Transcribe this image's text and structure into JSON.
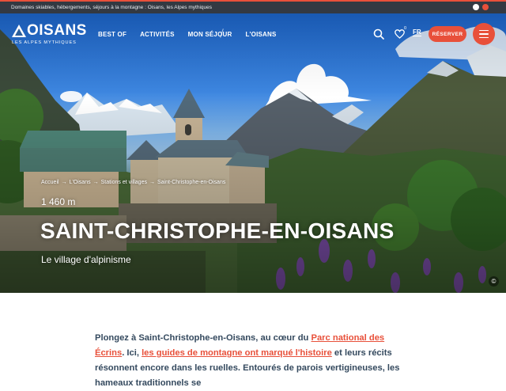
{
  "topbar": {
    "text": "Domaines skiables, hébergements, séjours à la montagne : Oisans, les Alpes mythiques"
  },
  "logo": {
    "name": "OISANS",
    "tagline": "LES ALPES MYTHIQUES"
  },
  "nav": {
    "items": [
      "BEST OF",
      "ACTIVITÉS",
      "MON SÉJOUR",
      "L'OISANS"
    ]
  },
  "header_actions": {
    "search_icon": "search-icon",
    "favorites_count": "0",
    "language": "FR",
    "reserve_label": "RÉSERVER",
    "menu_icon": "hamburger-icon"
  },
  "hero": {
    "breadcrumb": [
      "Accueil",
      "L'Oisans",
      "Stations et villages",
      "Saint-Christophe-en-Oisans"
    ],
    "altitude": "1 460 m",
    "title": "SAINT-CHRISTOPHE-EN-OISANS",
    "subtitle": "Le village d'alpinisme",
    "copyright_symbol": "©"
  },
  "intro": {
    "part1": "Plongez à Saint-Christophe-en-Oisans, au cœur du ",
    "link1": "Parc national des Écrins",
    "part2": ". Ici, ",
    "link2": "les guides de montagne ont marqué l'histoire",
    "part3": " et leurs récits résonnent encore dans les ruelles. Entourés de parois vertigineuses, les hameaux traditionnels se"
  },
  "colors": {
    "accent": "#e8503a",
    "topbar": "#333942",
    "text": "#34495e"
  }
}
